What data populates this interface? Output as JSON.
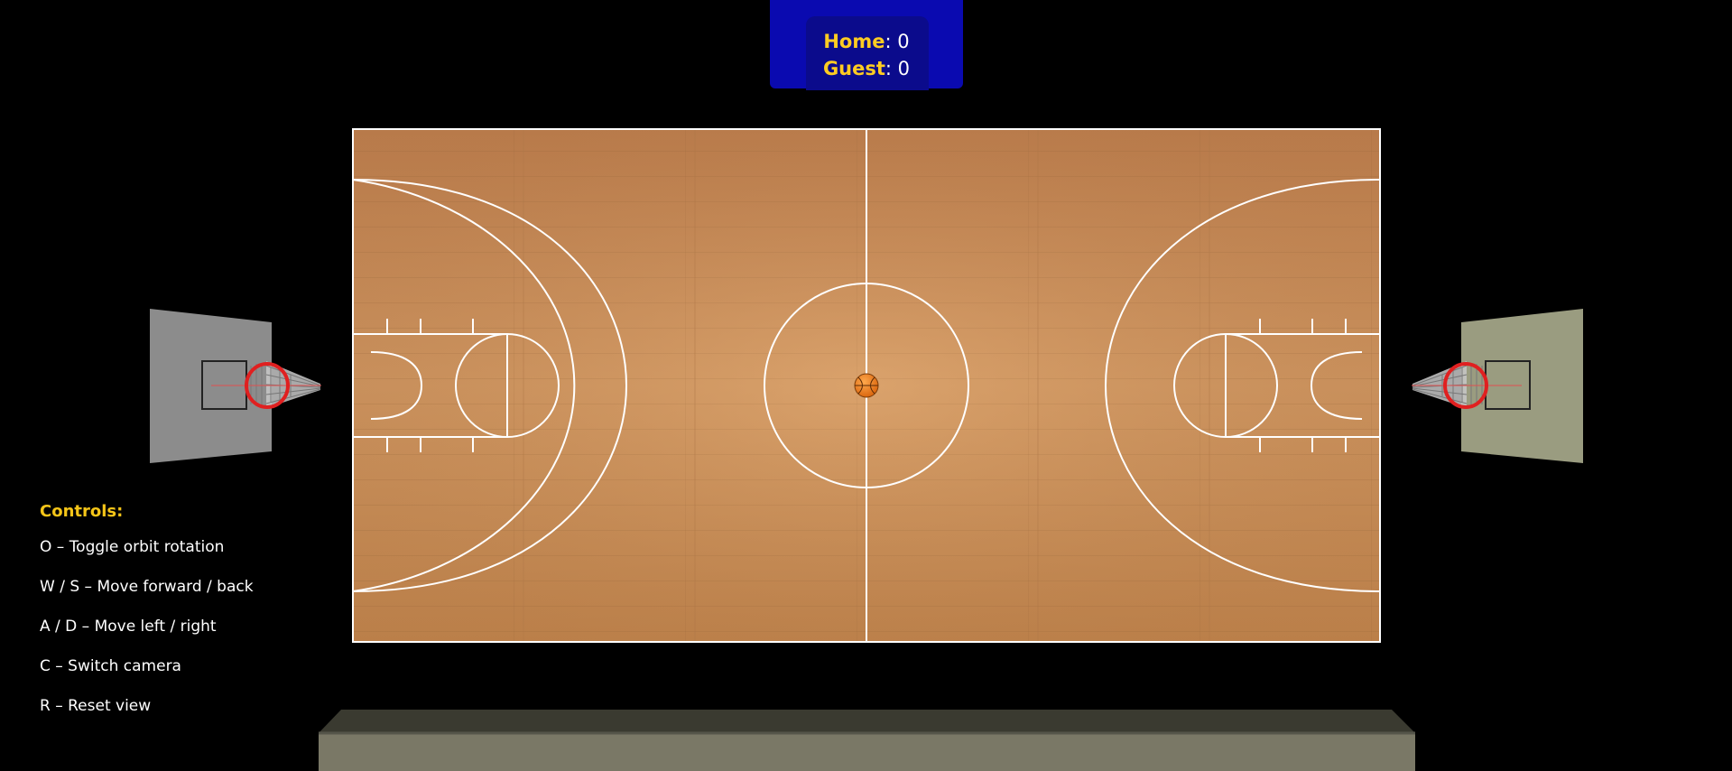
{
  "scoreboard": {
    "home_label": "Home",
    "home_score": "0",
    "guest_label": "Guest",
    "guest_score": "0"
  },
  "controls": {
    "title": "Controls:",
    "items": [
      "O – Toggle orbit rotation",
      "W / S – Move forward / back",
      "A / D – Move left / right",
      "C – Switch camera",
      "R – Reset view"
    ]
  },
  "colors": {
    "court_wood": "#c98a52",
    "court_lines": "#ffffff",
    "scoreboard_bg": "#0a0ab0",
    "score_label": "#ffcc22",
    "controls_title": "#f5c518",
    "rim": "#e02020",
    "backboard_left": "#8c8c8c",
    "backboard_right": "#9a9c80",
    "stand_top": "#3a3a30",
    "stand_front": "#7a7866"
  }
}
